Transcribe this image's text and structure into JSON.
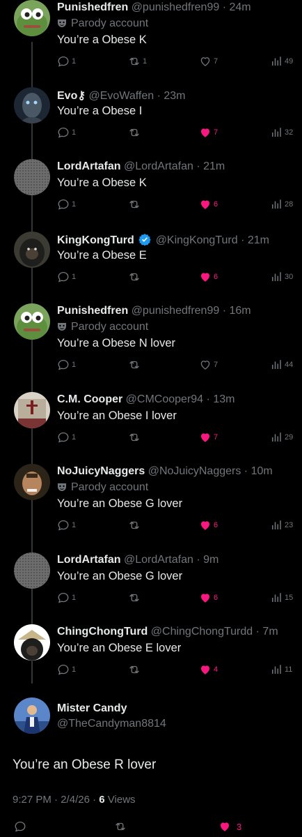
{
  "replies": [
    {
      "name": "Punishedfren",
      "handle": "@punishedfren99",
      "time": "24m",
      "parody": "Parody account",
      "text": "You’re a Obese K",
      "replies": "1",
      "reposts": "1",
      "likes": "7",
      "liked": false,
      "views": "49"
    },
    {
      "name": "Evo⚷",
      "handle": "@EvoWaffen",
      "time": "23m",
      "parody": "",
      "text": "You’re a Obese I",
      "replies": "1",
      "reposts": "",
      "likes": "7",
      "liked": true,
      "views": "32"
    },
    {
      "name": "LordArtafan",
      "handle": "@LordArtafan",
      "time": "21m",
      "parody": "",
      "text": "You’re a Obese K",
      "replies": "1",
      "reposts": "",
      "likes": "6",
      "liked": true,
      "views": "28"
    },
    {
      "name": "KingKongTurd",
      "handle": "@KingKongTurd",
      "time": "21m",
      "parody": "",
      "text": "You’re a Obese E",
      "replies": "1",
      "reposts": "",
      "likes": "6",
      "liked": true,
      "views": "30",
      "verified": true
    },
    {
      "name": "Punishedfren",
      "handle": "@punishedfren99",
      "time": "16m",
      "parody": "Parody account",
      "text": "You’re a Obese N lover",
      "replies": "1",
      "reposts": "",
      "likes": "7",
      "liked": false,
      "views": "44"
    },
    {
      "name": "C.M. Cooper",
      "handle": "@CMCooper94",
      "time": "13m",
      "parody": "",
      "text": "You’re an Obese I lover",
      "replies": "1",
      "reposts": "",
      "likes": "7",
      "liked": true,
      "views": "29"
    },
    {
      "name": "NoJuicyNaggers",
      "handle": "@NoJuicyNaggers",
      "time": "10m",
      "parody": "Parody account",
      "text": "You’re an Obese G lover",
      "replies": "1",
      "reposts": "",
      "likes": "6",
      "liked": true,
      "views": "23"
    },
    {
      "name": "LordArtafan",
      "handle": "@LordArtafan",
      "time": "9m",
      "parody": "",
      "text": "You’re an Obese G lover",
      "replies": "1",
      "reposts": "",
      "likes": "6",
      "liked": true,
      "views": "15"
    },
    {
      "name": "ChingChongTurd",
      "handle": "@ChingChongTurdd",
      "time": "7m",
      "parody": "",
      "text": "You’re an Obese E lover",
      "replies": "1",
      "reposts": "",
      "likes": "4",
      "liked": true,
      "views": "11"
    }
  ],
  "main_post": {
    "name": "Mister Candy",
    "handle": "@TheCandyman8814",
    "text": "You’re an Obese R lover",
    "time": "9:27 PM",
    "date": "2/4/26",
    "views_count": "6",
    "views_label": "Views",
    "likes": "3"
  },
  "colors": {
    "like": "#f91880",
    "muted": "#71767b",
    "text": "#e7e9ea",
    "verified": "#1d9bf0"
  }
}
